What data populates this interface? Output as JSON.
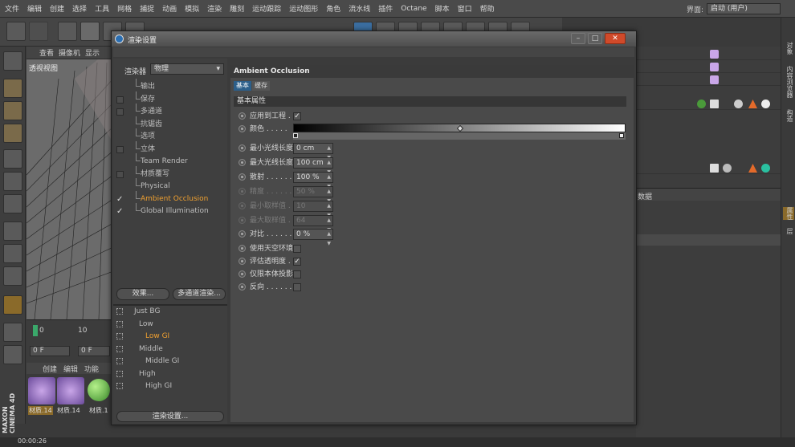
{
  "menubar": {
    "items": [
      "文件",
      "编辑",
      "创建",
      "选择",
      "工具",
      "网格",
      "捕捉",
      "动画",
      "模拟",
      "渲染",
      "雕刻",
      "运动跟踪",
      "运动图形",
      "角色",
      "流水线",
      "插件",
      "Octane",
      "脚本",
      "窗口",
      "帮助"
    ],
    "layout_label": "界面:",
    "layout_value": "启动 (用户)"
  },
  "viewport": {
    "menu": [
      "查看",
      "摄像机",
      "显示"
    ],
    "label": "透视视图"
  },
  "timeline": {
    "frame_start": "0",
    "frame_10": "10",
    "field_left": "0 F",
    "field_right": "0 F"
  },
  "material_bar": {
    "items": [
      "创建",
      "编辑",
      "功能"
    ],
    "labels": [
      "材质.14",
      "材质.14",
      "材质.1"
    ]
  },
  "status": {
    "time": "00:00:26"
  },
  "brand": {
    "name": "MAXON CINEMA 4D"
  },
  "attributes_header": "数据",
  "dialog": {
    "title": "渲染设置",
    "renderer_label": "渲染器",
    "renderer_value": "物理",
    "items": [
      {
        "label": "输出",
        "checkbox": false,
        "checked": false
      },
      {
        "label": "保存",
        "checkbox": true,
        "checked": false
      },
      {
        "label": "多通道",
        "checkbox": true,
        "checked": false
      },
      {
        "label": "抗锯齿",
        "checkbox": false,
        "checked": false
      },
      {
        "label": "选项",
        "checkbox": false,
        "checked": false
      },
      {
        "label": "立体",
        "checkbox": true,
        "checked": false
      },
      {
        "label": "Team Render",
        "checkbox": false,
        "checked": false
      },
      {
        "label": "材质覆写",
        "checkbox": true,
        "checked": false
      },
      {
        "label": "Physical",
        "checkbox": false,
        "checked": false
      },
      {
        "label": "Ambient Occlusion",
        "checkbox": true,
        "checked": true,
        "active": true
      },
      {
        "label": "Global Illumination",
        "checkbox": true,
        "checked": true
      }
    ],
    "effects_button": "效果...",
    "multipass_button": "多通道渲染...",
    "presets": [
      {
        "label": "Just BG",
        "indent": 0
      },
      {
        "label": "Low",
        "indent": 1
      },
      {
        "label": "Low GI",
        "indent": 2,
        "active": true
      },
      {
        "label": "Middle",
        "indent": 1
      },
      {
        "label": "Middle GI",
        "indent": 2
      },
      {
        "label": "High",
        "indent": 1
      },
      {
        "label": "High GI",
        "indent": 2
      }
    ],
    "render_settings_button": "渲染设置...",
    "section_title": "Ambient Occlusion",
    "tabs": [
      "基本",
      "缓存"
    ],
    "group_title": "基本属性",
    "params": [
      {
        "label": "应用到工程 . .",
        "type": "check",
        "value": "✓"
      },
      {
        "label": "颜色 . . . . .",
        "type": "gradient"
      },
      {
        "label": "最小光线长度",
        "type": "num",
        "value": "0 cm"
      },
      {
        "label": "最大光线长度",
        "type": "num",
        "value": "100 cm"
      },
      {
        "label": "散射 . . . . . .",
        "type": "num",
        "value": "100 %"
      },
      {
        "label": "精度 . . . . . .",
        "type": "num",
        "value": "50 %",
        "disabled": true
      },
      {
        "label": "最小取样值 . .",
        "type": "num",
        "value": "10",
        "disabled": true
      },
      {
        "label": "最大取样值 . .",
        "type": "num",
        "value": "64",
        "disabled": true
      },
      {
        "label": "对比 . . . . . .",
        "type": "num",
        "value": "0 %"
      },
      {
        "label": "使用天空环境",
        "type": "check",
        "value": ""
      },
      {
        "label": "评估透明度 . .",
        "type": "check",
        "value": "✓"
      },
      {
        "label": "仅限本体投影",
        "type": "check",
        "value": ""
      },
      {
        "label": "反向 . . . . . .",
        "type": "check",
        "value": ""
      }
    ]
  },
  "right_tabs": [
    "对象",
    "内容浏览器",
    "构造",
    "层",
    "属性"
  ]
}
